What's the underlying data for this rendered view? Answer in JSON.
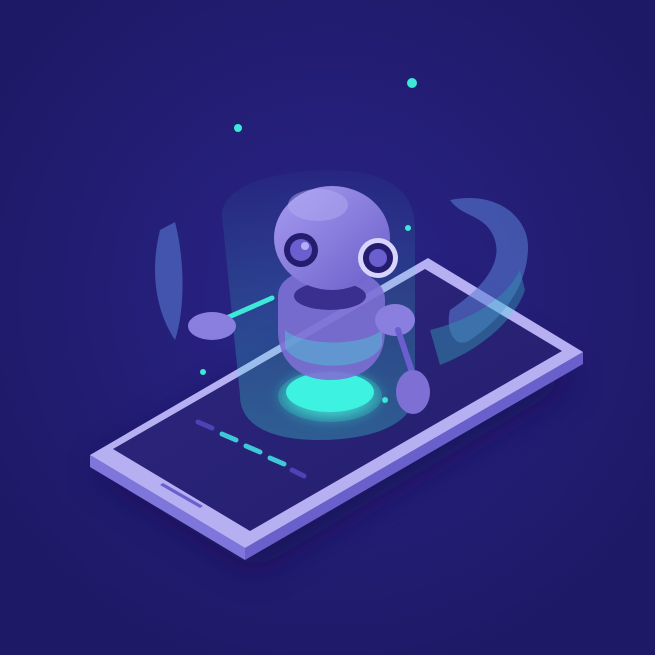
{
  "illustration": {
    "subject": "robot-hologram-over-smartphone",
    "colors": {
      "background": "#1e1966",
      "background_glow": "#2a2488",
      "phone_frame_top": "#b6b0f2",
      "phone_frame_side": "#7f76db",
      "phone_screen": "#2a2379",
      "hologram_cyan": "#3de8d8",
      "robot_body": "#7d6fd4",
      "robot_shade": "#5b4fb6",
      "robot_eye_ring": "#241c6e",
      "robot_eye": "#6b5fd0"
    },
    "icons": [
      "robot-icon",
      "smartphone-icon",
      "hologram-beam-icon"
    ]
  }
}
